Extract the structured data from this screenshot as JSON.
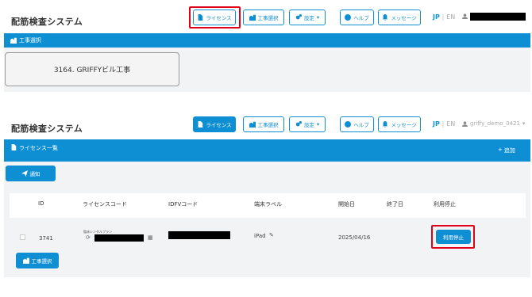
{
  "app": {
    "title": "配筋検査システム"
  },
  "toolbar": {
    "license_label": "ライセンス",
    "site_select_label": "工事選択",
    "settings_label": "設定",
    "help_label": "ヘルプ",
    "message_label": "メッセージ"
  },
  "lang": {
    "jp": "JP",
    "sep": "|",
    "en": "EN"
  },
  "user": {
    "name": "griffy_demo_0421"
  },
  "site_panel": {
    "header": "工事選択",
    "site_name": "3164. GRIFFYビル工事"
  },
  "license_panel": {
    "header": "ライセンス一覧",
    "add_label": "追加",
    "notify_label": "通知",
    "columns": [
      "ID",
      "ライセンスコード",
      "IDFVコード",
      "端末ラベル",
      "開始日",
      "終了日",
      "利用停止"
    ],
    "row": {
      "id": "3741",
      "plan": "臨床レンタルプラン",
      "device_label": "iPad",
      "start_date": "2025/04/16",
      "end_date": "",
      "stop_label": "利用停止"
    },
    "site_select_label": "工事選択"
  },
  "colors": {
    "accent": "#0f8fd3",
    "highlight": "#e0001a"
  }
}
